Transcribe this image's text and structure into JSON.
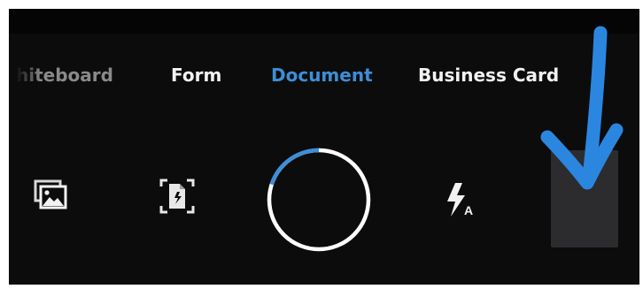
{
  "mode_tabs": [
    {
      "label": "Whiteboard",
      "visible_text": "hiteboard",
      "state": "partially-visible"
    },
    {
      "label": "Form",
      "state": "inactive"
    },
    {
      "label": "Document",
      "state": "active"
    },
    {
      "label": "Business Card",
      "state": "inactive"
    }
  ],
  "controls": {
    "gallery_icon": "image-gallery-icon",
    "auto_capture_icon": "auto-capture-icon",
    "shutter_icon": "shutter-ring",
    "flash_icon": "flash-auto-icon",
    "flash_badge": "A",
    "thumbnail": "captured-page-thumbnail",
    "shutter_progress": 0.2
  },
  "annotation": {
    "icon": "blue-arrow-down-icon",
    "color": "#2b86e0"
  },
  "colors": {
    "background": "#0c0c0c",
    "active_tab": "#3c8ed8",
    "tab_text": "#f2f2f2",
    "shutter_ring": "#ffffff",
    "shutter_progress": "#3c8ed8",
    "thumbnail": "#2c2c2e"
  }
}
